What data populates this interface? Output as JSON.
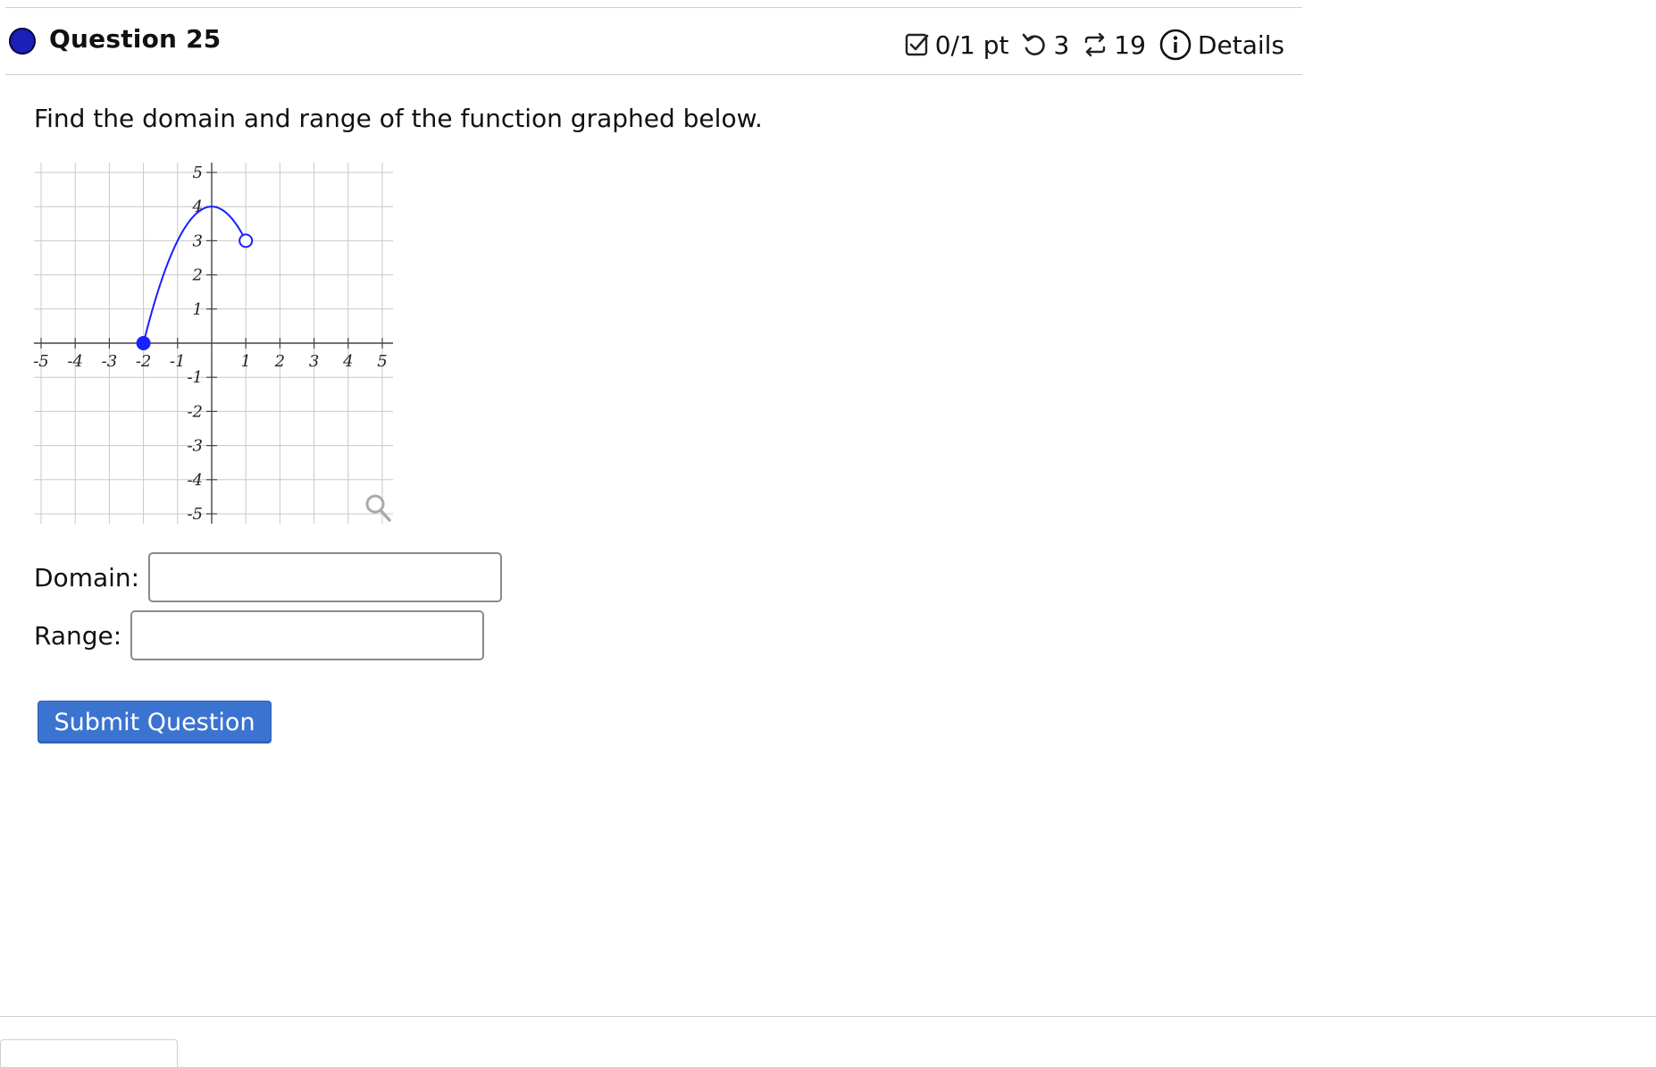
{
  "question": {
    "title": "Question 25",
    "prompt": "Find the domain and range of the function graphed below."
  },
  "meta": {
    "score": "0/1 pt",
    "retries": "3",
    "attempts": "19",
    "details_label": "Details",
    "icons": [
      "checkbox-icon",
      "undo-icon",
      "repeat-icon",
      "info-icon"
    ]
  },
  "graph": {
    "x_ticks": [
      "-5",
      "-4",
      "-3",
      "-2",
      "-1",
      "1",
      "2",
      "3",
      "4",
      "5"
    ],
    "y_ticks": [
      "5",
      "4",
      "3",
      "2",
      "1",
      "-1",
      "-2",
      "-3",
      "-4",
      "-5"
    ],
    "xlim": [
      -5,
      5
    ],
    "ylim": [
      -5,
      5
    ],
    "curve_color": "#1a20ff",
    "closed_point": [
      -2,
      0
    ],
    "open_point": [
      1,
      3
    ],
    "vertex": [
      0,
      4
    ],
    "zoom_icon": "magnifier-icon"
  },
  "fields": {
    "domain_label": "Domain:",
    "domain_value": "",
    "range_label": "Range:",
    "range_value": ""
  },
  "submit_label": "Submit Question"
}
